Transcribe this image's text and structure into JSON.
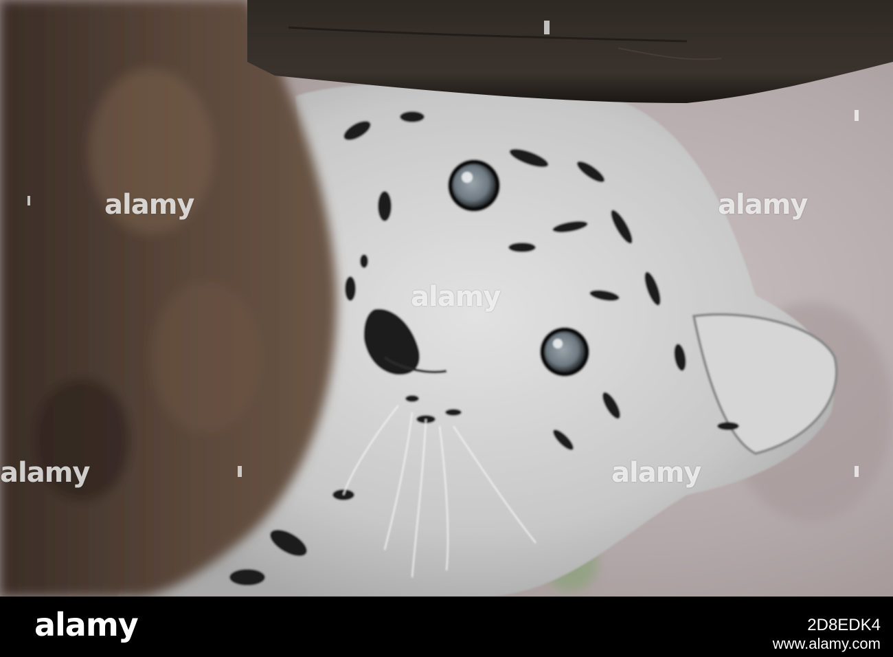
{
  "photo": {
    "subject": "snow leopard cub peeking under a log",
    "colors": {
      "background": "#b8aeb0",
      "trunk": "#4a3a30",
      "log": "#2a2420",
      "fur": "#cfcfcf",
      "spots": "#1c1c1c",
      "eye": "#7f8b93"
    }
  },
  "watermark": {
    "text": "alamy"
  },
  "footer": {
    "brand": "alamy",
    "image_id": "2D8EDK4",
    "url": "www.alamy.com"
  }
}
